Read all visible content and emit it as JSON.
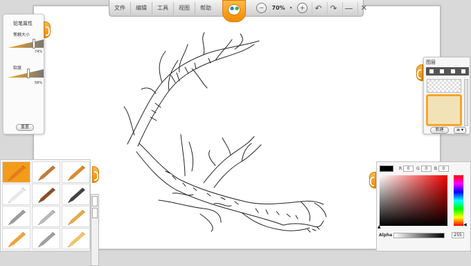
{
  "toolbar": {
    "menus": [
      "文件",
      "编辑",
      "工具",
      "视图",
      "帮助"
    ],
    "zoom_value": "70%",
    "zoom_out_icon": "minus-icon",
    "zoom_in_icon": "plus-icon",
    "undo_icon": "undo-icon",
    "redo_icon": "redo-icon",
    "minimize_icon": "minimize-icon",
    "close_icon": "close-icon"
  },
  "pencil_panel": {
    "title": "铅笔属性",
    "size_label": "笔触大小",
    "size_value": "74%",
    "softness_label": "软度",
    "softness_value": "58%",
    "reset_label": "重置"
  },
  "tools": [
    {
      "name": "pencil-tool-icon",
      "color": "#e47c1a",
      "selected": true
    },
    {
      "name": "crayon-tool-icon",
      "color": "#c27a3a"
    },
    {
      "name": "brush-tool-icon",
      "color": "#d88a2e"
    },
    {
      "name": "eraser-tool-icon",
      "color": "#e9e9e9"
    },
    {
      "name": "marker-tool-icon",
      "color": "#8a4f2a"
    },
    {
      "name": "ink-pen-tool-icon",
      "color": "#444444"
    },
    {
      "name": "spray-tool-icon",
      "color": "#9c9c9c"
    },
    {
      "name": "palette-knife-tool-icon",
      "color": "#b8b8b8"
    },
    {
      "name": "roller-tool-icon",
      "color": "#e8a84a"
    },
    {
      "name": "bucket-tool-icon",
      "color": "#f0a040"
    },
    {
      "name": "fine-brush-tool-icon",
      "color": "#a0a0a0"
    },
    {
      "name": "chalk-tool-icon",
      "color": "#f2c46a"
    }
  ],
  "layers_panel": {
    "title": "图层",
    "new_layer_label": "新建",
    "menu_label": "≡ ▾"
  },
  "color_panel": {
    "current_color": "#000000",
    "r_label": "R",
    "r_value": "0",
    "g_label": "G",
    "g_value": "0",
    "b_label": "B",
    "b_value": "0",
    "alpha_label": "Alpha",
    "alpha_value": "255"
  }
}
